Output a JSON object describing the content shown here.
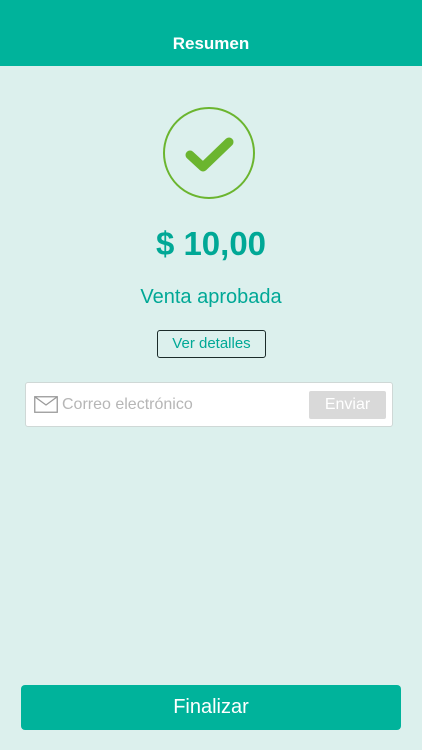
{
  "header": {
    "title": "Resumen"
  },
  "summary": {
    "amount": "$ 10,00",
    "status": "Venta aprobada",
    "details_label": "Ver detalles"
  },
  "email": {
    "placeholder": "Correo electrónico",
    "value": "",
    "send_label": "Enviar"
  },
  "footer": {
    "finish_label": "Finalizar"
  },
  "icons": {
    "success": "check-circle-icon",
    "email": "envelope-icon"
  },
  "colors": {
    "accent": "#00b39b",
    "text_accent": "#00a896",
    "success": "#6bb52f",
    "background": "#dcf0ed",
    "disabled_button": "#d9d9d9"
  }
}
